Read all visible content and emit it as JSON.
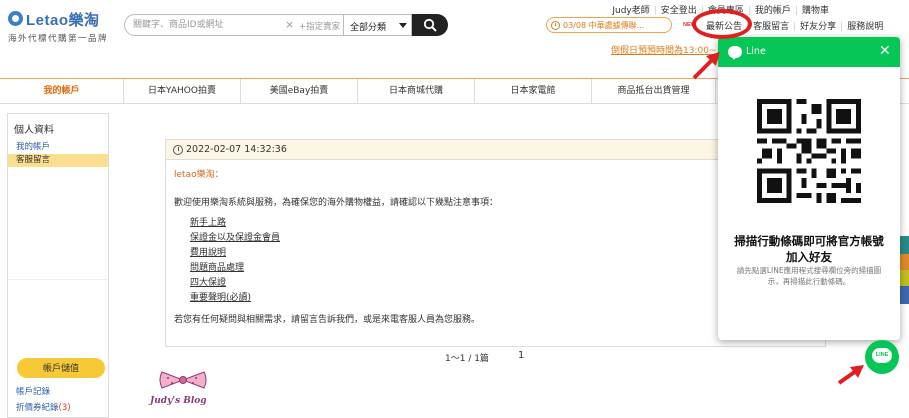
{
  "brand": {
    "logo_text": "Letao樂淘",
    "tagline": "海外代標代購第一品牌"
  },
  "search": {
    "placeholder": "關鍵字、商品ID或網址",
    "clear_icon": "×",
    "assign_store": "+指定賣家",
    "category": "全部分類"
  },
  "top_links": [
    "Judy老師",
    "安全登出",
    "會員專區",
    "我的帳戶",
    "購物車"
  ],
  "notice": {
    "text": "03/08 中華處據傳聯...",
    "new_badge": "NEW"
  },
  "sub_links": [
    "最新公告",
    "客服留言",
    "好友分享",
    "服務說明"
  ],
  "promo_link": "倒假日預預時間為13:00~...",
  "nav": {
    "tabs": [
      "我的帳戶",
      "日本YAHOO拍賣",
      "美國eBay拍賣",
      "日本商城代購",
      "日本家電館",
      "商品抵台出貨管理"
    ],
    "active_index": 0
  },
  "sidebar": {
    "title": "個人資料",
    "items": [
      "我的帳戶",
      "客服留言"
    ],
    "active_index": 1,
    "deposit_button": "帳戶儲值",
    "bottom_links": [
      "帳戶記錄",
      "折價券紀錄"
    ],
    "coupon_count": "(3)"
  },
  "message": {
    "timestamp": "2022-02-07 14:32:36",
    "sender": "letao樂淘：",
    "intro": "歡迎使用樂淘系統與服務，為確保您的海外購物權益，請確認以下幾點注意事項：",
    "links": [
      "新手上路",
      "保證金以及保證金會員",
      "費用說明",
      "問題商品處理",
      "四大保證",
      "重要聲明(必讀)"
    ],
    "footer": "若您有任何疑問與相關需求，請留言告訴我們，或是來電客服人員為您服務。"
  },
  "pagination": {
    "summary": "1～1 / 1篇",
    "current_page": "1"
  },
  "line_popup": {
    "header": "Line",
    "close_icon": "✕",
    "title": "掃描行動條碼即可將官方帳號加入好友",
    "description": "請先點選LINE應用程式搜尋欄位旁的掃描圖示，再掃描此行動條碼。",
    "fab_label": "LINE"
  },
  "watermark": "Judy's Blog",
  "colors": {
    "line_green": "#06c755",
    "accent_orange": "#e46b0d",
    "sidebar_active": "#fcdf8e",
    "deposit_yellow": "#f7c937",
    "annotation_red": "#e02020"
  }
}
